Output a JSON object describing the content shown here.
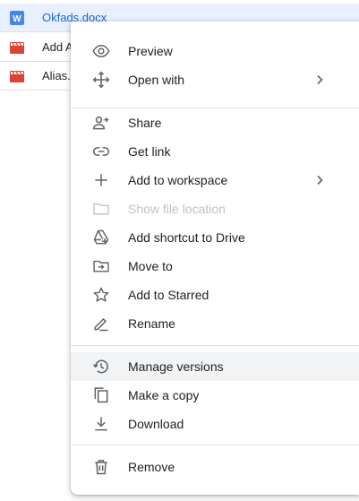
{
  "files": [
    {
      "name": "Okfads.docx",
      "icon": "word-doc-icon",
      "selected": true
    },
    {
      "name": "Add A",
      "icon": "video-file-icon",
      "selected": false
    },
    {
      "name": "Alias.",
      "icon": "video-file-icon",
      "selected": false
    }
  ],
  "menu": {
    "preview": "Preview",
    "open_with": "Open with",
    "share": "Share",
    "get_link": "Get link",
    "add_to_workspace": "Add to workspace",
    "show_file_location": "Show file location",
    "add_shortcut": "Add shortcut to Drive",
    "move_to": "Move to",
    "add_starred": "Add to Starred",
    "rename": "Rename",
    "manage_versions": "Manage versions",
    "make_copy": "Make a copy",
    "download": "Download",
    "remove": "Remove"
  },
  "colors": {
    "highlight": "#f2ee00",
    "selected_row": "#e8f0fe",
    "word_icon": "#4a86e8",
    "video_icon": "#db4437",
    "icon_gray": "#5f6368",
    "disabled": "#bdc1c6"
  }
}
